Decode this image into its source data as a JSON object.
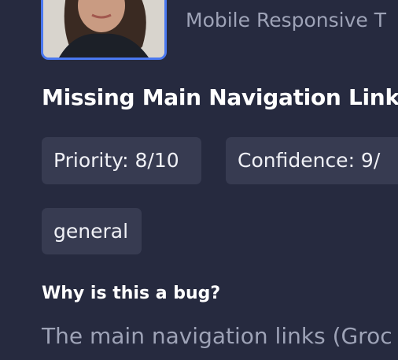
{
  "card": {
    "subtitle": "Mobile Responsive T",
    "title": "Missing Main Navigation Link",
    "priority": "Priority: 8/10",
    "confidence": "Confidence: 9/",
    "tag": "general",
    "why_heading": "Why is this a bug?",
    "description": "The main navigation links (Groc"
  },
  "colors": {
    "background": "#262a3f",
    "chip": "#373b51",
    "thumbnail_border": "#4a78f0"
  }
}
